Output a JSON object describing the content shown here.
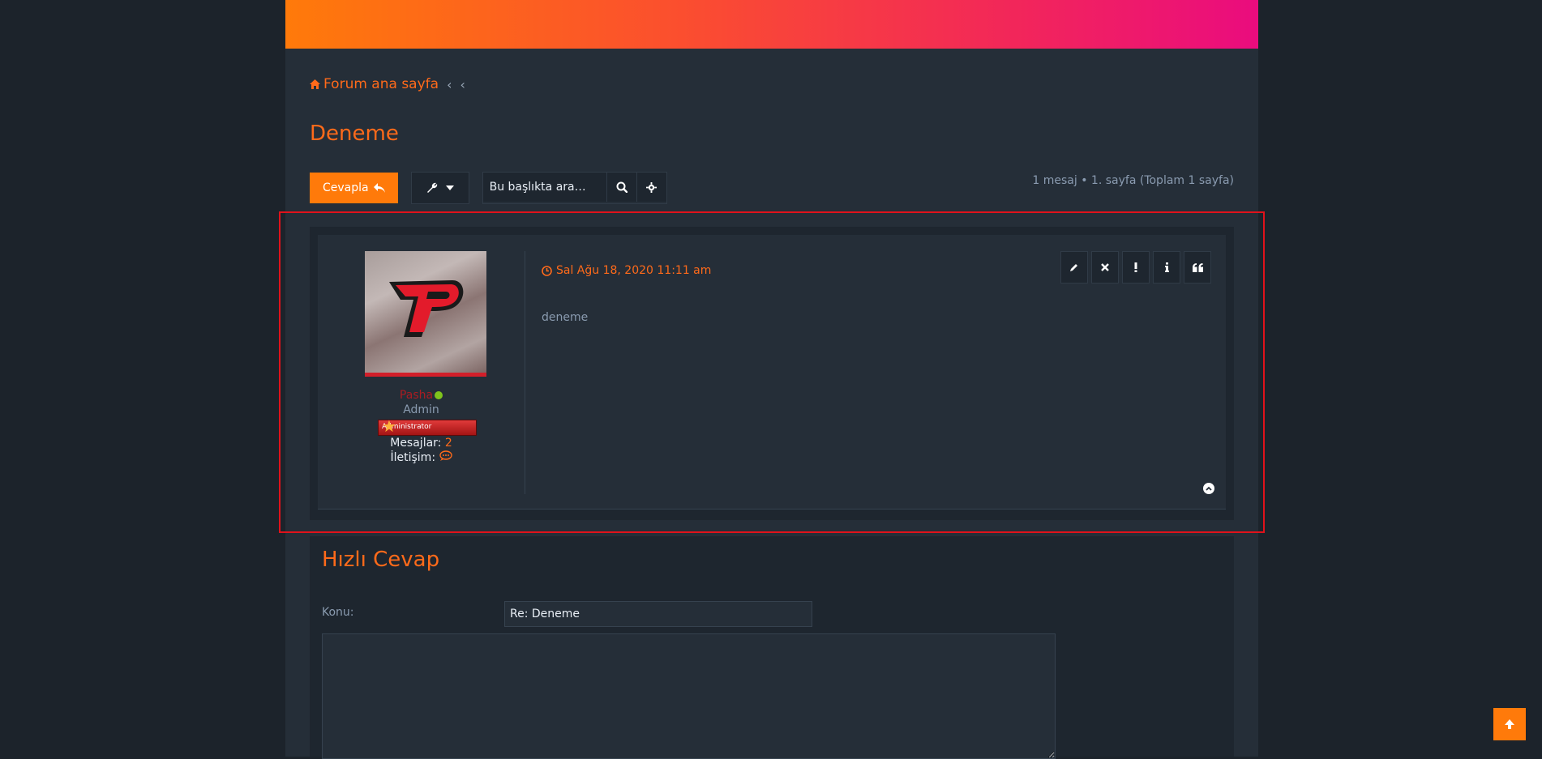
{
  "breadcrumb": {
    "home_label": "Forum ana sayfa",
    "sep1": "‹",
    "sep2": "‹"
  },
  "topic": {
    "title": "Deneme"
  },
  "toolbar": {
    "reply_label": "Cevapla",
    "search_placeholder": "Bu başlıkta ara…",
    "pagination": "1 mesaj • 1. sayfa (Toplam 1 sayfa)"
  },
  "post": {
    "username": "Pasha",
    "rank": "Admin",
    "rank_image_text": "Administrator",
    "posts_label": "Mesajlar:",
    "posts_count": "2",
    "contact_label": "İletişim:",
    "date": "Sal Ağu 18, 2020 11:11 am",
    "content": "deneme"
  },
  "quick_reply": {
    "title": "Hızlı Cevap",
    "subject_label": "Konu:",
    "subject_value": "Re: Deneme"
  },
  "colors": {
    "accent": "#ff7a0a",
    "link": "#ff6a1a",
    "highlight": "#e0121b"
  }
}
